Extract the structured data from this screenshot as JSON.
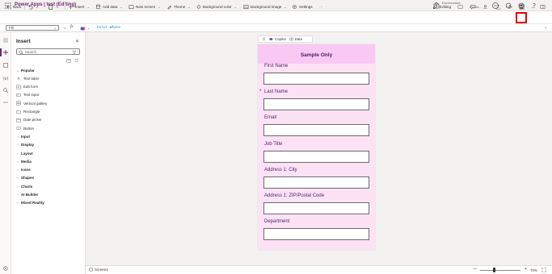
{
  "app": {
    "title": "Power Apps | test (Editing)"
  },
  "environment": {
    "label": "Environment",
    "name": "Enviro..."
  },
  "commands": {
    "back": "Back",
    "insert": "Insert",
    "add_data": "Add data",
    "new_screen": "New screen",
    "theme": "Theme",
    "background_color": "Background color",
    "background_image": "Background image",
    "settings": "Settings",
    "more": "···",
    "editing": "Editing"
  },
  "formula": {
    "property": "Fill",
    "fx": "fx",
    "value": "Color.White"
  },
  "insert_panel": {
    "title": "Insert",
    "search_placeholder": "Search",
    "popular_label": "Popular",
    "popular_items": [
      {
        "label": "Text label",
        "icon": "text-label-icon"
      },
      {
        "label": "Edit form",
        "icon": "edit-form-icon"
      },
      {
        "label": "Text input",
        "icon": "text-input-icon"
      },
      {
        "label": "Vertical gallery",
        "icon": "gallery-icon"
      },
      {
        "label": "Rectangle",
        "icon": "rectangle-icon"
      },
      {
        "label": "Date picker",
        "icon": "date-picker-icon"
      },
      {
        "label": "Button",
        "icon": "button-icon"
      }
    ],
    "categories": [
      "Input",
      "Display",
      "Layout",
      "Media",
      "Icons",
      "Shapes",
      "Charts",
      "AI Builder",
      "Mixed Reality"
    ]
  },
  "screen_toolbar": {
    "copilot": "Copilot",
    "data": "Data"
  },
  "form": {
    "title": "Sample Only",
    "fields": [
      {
        "label": "First Name",
        "required": false,
        "value": ""
      },
      {
        "label": "Last Name",
        "required": true,
        "value": ""
      },
      {
        "label": "Email",
        "required": false,
        "value": ""
      },
      {
        "label": "Job Title",
        "required": false,
        "value": ""
      },
      {
        "label": "Address 1: City",
        "required": false,
        "value": ""
      },
      {
        "label": "Address 1: ZIP/Postal Code",
        "required": false,
        "value": ""
      },
      {
        "label": "Department",
        "required": false,
        "value": ""
      }
    ],
    "required_marker": "*"
  },
  "status": {
    "screen_name": "Screen1",
    "zoom": "70%",
    "zoom_minus": "—",
    "zoom_plus": "+"
  },
  "colors": {
    "brand": "#742774",
    "form_bg": "#fde2f6",
    "form_header": "#f9c8f3",
    "form_text": "#4b1d6b",
    "highlight": "#e60000"
  }
}
